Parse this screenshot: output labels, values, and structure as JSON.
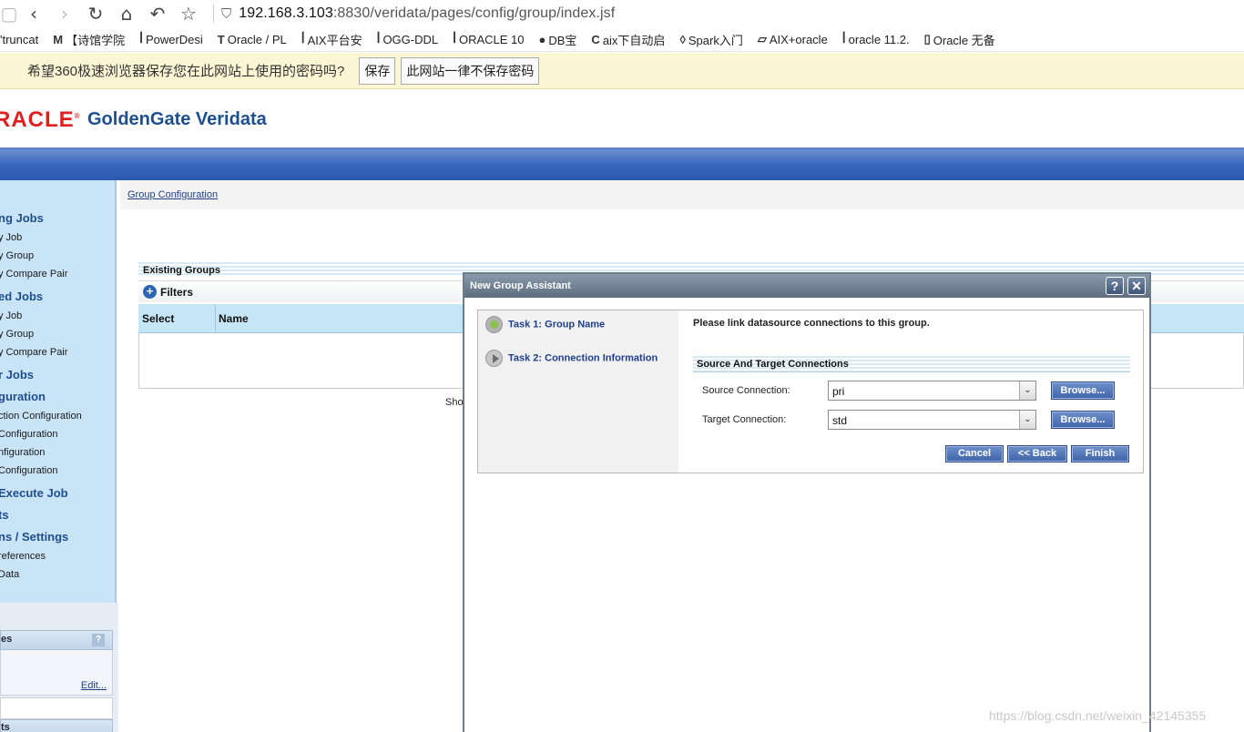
{
  "browser": {
    "url_host": "192.168.3.103",
    "url_rest": ":8830/veridata/pages/config/group/index.jsf",
    "bookmarks": [
      {
        "icon": "",
        "label": "'truncat"
      },
      {
        "icon": "M",
        "label": "【诗馆学院"
      },
      {
        "icon": "ꟾ",
        "label": "PowerDesi"
      },
      {
        "icon": "T",
        "label": "Oracle / PL"
      },
      {
        "icon": "ꟾ",
        "label": "AIX平台安"
      },
      {
        "icon": "ꟾ",
        "label": "OGG-DDL"
      },
      {
        "icon": "ꟾ",
        "label": "ORACLE 10"
      },
      {
        "icon": "●",
        "label": "DB宝"
      },
      {
        "icon": "C",
        "label": "aix下自动启"
      },
      {
        "icon": "◊",
        "label": "Spark入门"
      },
      {
        "icon": "▱",
        "label": "AIX+oracle"
      },
      {
        "icon": "ꟾ",
        "label": "oracle 11.2."
      },
      {
        "icon": "▯",
        "label": "Oracle 无备"
      }
    ],
    "password_prompt": {
      "message": "希望360极速浏览器保存您在此网站上使用的密码吗?",
      "save": "保存",
      "never": "此网站一律不保存密码"
    }
  },
  "app": {
    "logo": "RACLE",
    "title": "GoldenGate Veridata"
  },
  "nav": {
    "sections": [
      {
        "label": "ng Jobs",
        "items": [
          "y Job",
          "y Group",
          "y Compare Pair"
        ]
      },
      {
        "label": "ed Jobs",
        "items": [
          "y Job",
          "y Group",
          "y Compare Pair"
        ]
      },
      {
        "label": "r Jobs",
        "items": []
      },
      {
        "label": "guration",
        "items": [
          "ction Configuration",
          "Configuration",
          "nfiguration",
          "Configuration"
        ]
      },
      {
        "label": "Execute Job",
        "items": []
      },
      {
        "label": "ts",
        "items": []
      },
      {
        "label": "ns / Settings",
        "items": [
          "references",
          "Data"
        ]
      }
    ],
    "bottom_header": "es",
    "help": "?",
    "edit": "Edit...",
    "bottom_header2": "ts"
  },
  "main": {
    "breadcrumb": "Group Configuration",
    "existing_groups": "Existing Groups",
    "filters": "Filters",
    "columns": [
      "Select",
      "Name"
    ],
    "show": "Sho"
  },
  "dialog": {
    "title": "New Group Assistant",
    "help": "?",
    "close": "✕",
    "tasks": [
      "Task 1: Group Name",
      "Task 2: Connection Information"
    ],
    "message": "Please link datasource connections to this group.",
    "section": "Source And Target Connections",
    "source_label": "Source Connection:",
    "source_value": "pri",
    "target_label": "Target Connection:",
    "target_value": "std",
    "browse": "Browse...",
    "cancel": "Cancel",
    "back": "<< Back",
    "finish": "Finish"
  },
  "watermark": "https://blog.csdn.net/weixin_42145355"
}
